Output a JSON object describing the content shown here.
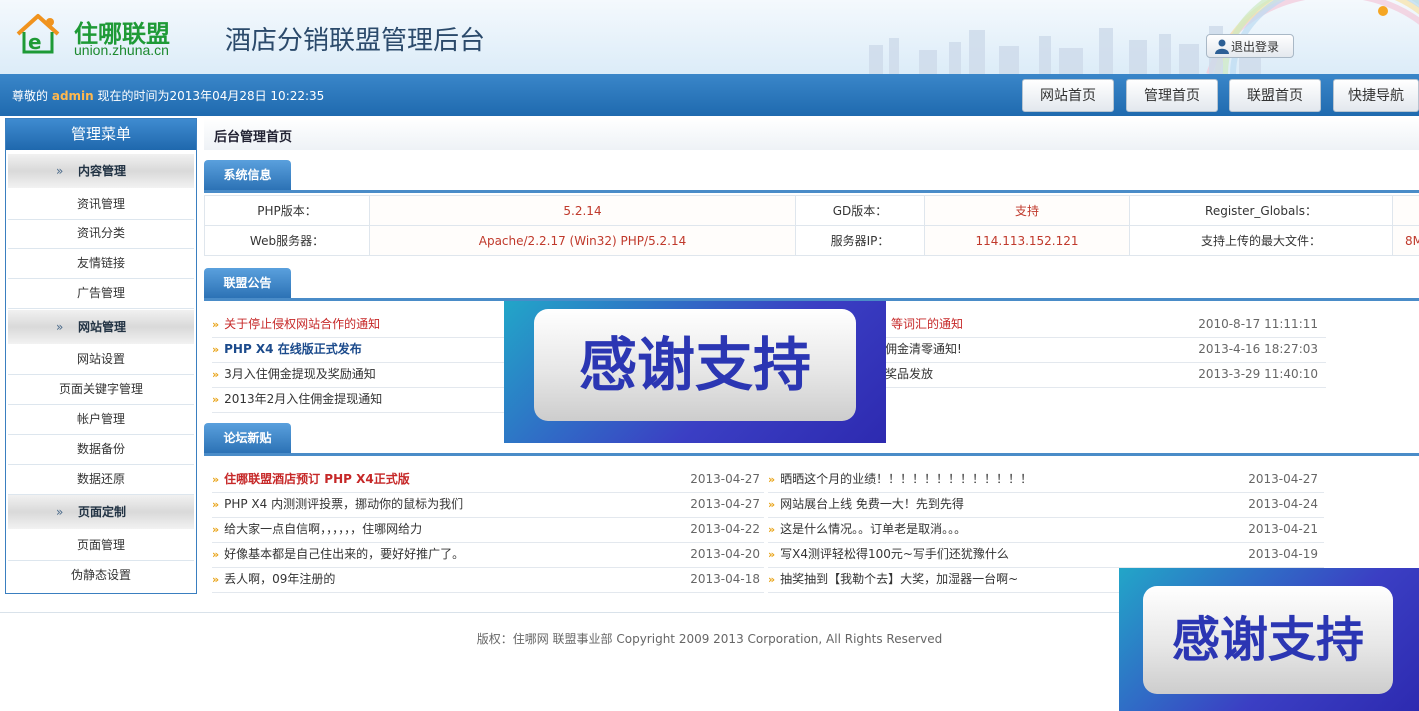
{
  "header": {
    "logo_cn": "住哪联盟",
    "logo_url": "union.zhuna.cn",
    "system_title": "酒店分销联盟管理后台",
    "logout_label": "退出登录"
  },
  "topbar": {
    "welcome_prefix": "尊敬的",
    "username": "admin",
    "welcome_suffix": "现在的时间为2013年04月28日 10:22:35",
    "nav": [
      "网站首页",
      "管理首页",
      "联盟首页",
      "快捷导航"
    ]
  },
  "sidebar": {
    "title": "管理菜单",
    "groups": [
      {
        "label": "内容管理",
        "items": [
          "资讯管理",
          "资讯分类",
          "友情链接",
          "广告管理"
        ]
      },
      {
        "label": "网站管理",
        "items": [
          "网站设置",
          "页面关键字管理",
          "帐户管理",
          "数据备份",
          "数据还原"
        ]
      },
      {
        "label": "页面定制",
        "items": [
          "页面管理",
          "伪静态设置"
        ]
      }
    ]
  },
  "main": {
    "breadcrumb": "后台管理首页",
    "system_info": {
      "tab": "系统信息",
      "rows": [
        [
          "PHP版本：",
          "5.2.14",
          "GD版本：",
          "支持",
          "Register_Globals：",
          ""
        ],
        [
          "Web服务器：",
          "Apache/2.2.17 (Win32) PHP/5.2.14",
          "服务器IP：",
          "114.113.152.121",
          "支持上传的最大文件：",
          "8M"
        ]
      ]
    },
    "notices": {
      "tab": "联盟公告",
      "left": [
        {
          "title": "关于停止侵权网站合作的通知",
          "style": "red"
        },
        {
          "title": "PHP X4 在线版正式发布",
          "style": "bold"
        },
        {
          "title": "3月入住佣金提现及奖励通知",
          "style": "normal"
        },
        {
          "title": "2013年2月入住佣金提现通知",
          "style": "normal"
        }
      ],
      "right": [
        {
          "title": "等词汇的通知",
          "date": "2010-8-17 11:11:11",
          "style": "red"
        },
        {
          "title": "佣金清零通知!",
          "date": "2013-4-16 18:27:03",
          "style": "normal"
        },
        {
          "title": "奖品发放",
          "date": "2013-3-29 11:40:10",
          "style": "normal"
        }
      ]
    },
    "forum": {
      "tab": "论坛新贴",
      "left": [
        {
          "title": "住哪联盟酒店预订 PHP X4正式版",
          "date": "2013-04-27",
          "style": "red-bold"
        },
        {
          "title": "PHP X4 内测测评投票，挪动你的鼠标为我们",
          "date": "2013-04-27",
          "style": "normal"
        },
        {
          "title": "给大家一点自信啊，，，，，，住哪网给力",
          "date": "2013-04-22",
          "style": "normal"
        },
        {
          "title": "好像基本都是自己住出来的，要好好推广了。",
          "date": "2013-04-20",
          "style": "normal"
        },
        {
          "title": "丢人啊，09年注册的",
          "date": "2013-04-18",
          "style": "normal"
        }
      ],
      "right": [
        {
          "title": "晒晒这个月的业绩！！！！！！！！！！！！！",
          "date": "2013-04-27",
          "style": "normal"
        },
        {
          "title": "网站展台上线 免费一大！先到先得",
          "date": "2013-04-24",
          "style": "normal"
        },
        {
          "title": "这是什么情况。。订单老是取消。。。",
          "date": "2013-04-21",
          "style": "normal"
        },
        {
          "title": "写X4测评轻松得100元~写手们还犹豫什么",
          "date": "2013-04-19",
          "style": "normal"
        },
        {
          "title": "抽奖抽到【我勒个去】大奖，加湿器一台啊~",
          "date": "",
          "style": "normal"
        }
      ]
    }
  },
  "overlay_text": "感谢支持",
  "footer": "版权：住哪网 联盟事业部 Copyright 2009 2013 Corporation, All Rights Reserved",
  "colors": {
    "accent": "#2a72b5",
    "notice_red": "#c62828",
    "bullet": "#e8a317",
    "logo_green": "#1e9a36"
  }
}
